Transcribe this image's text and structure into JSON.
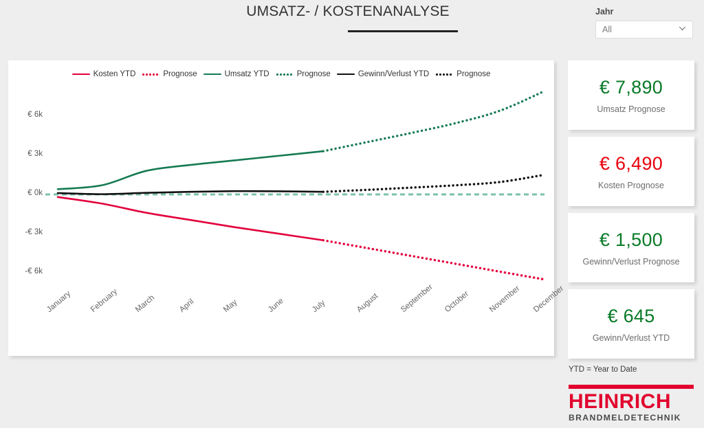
{
  "header": {
    "title": "UMSATZ- / KOSTENANALYSE"
  },
  "slicer": {
    "label": "Jahr",
    "value": "All",
    "icon": "chevron-down-icon"
  },
  "kpis": [
    {
      "value": "€ 7,890",
      "label": "Umsatz Prognose",
      "color": "#0a7a28"
    },
    {
      "value": "€ 6,490",
      "label": "Kosten Prognose",
      "color": "#e8000d"
    },
    {
      "value": "€ 1,500",
      "label": "Gewinn/Verlust Prognose",
      "color": "#0a7a28"
    },
    {
      "value": "€ 645",
      "label": "Gewinn/Verlust YTD",
      "color": "#0a7a28"
    }
  ],
  "footer": {
    "note": "YTD = Year to Date",
    "logo_name": "HEINRICH",
    "logo_sub": "BRANDMELDETECHNIK"
  },
  "chart_data": {
    "type": "line",
    "title": "UMSATZ- / KOSTENANALYSE",
    "xlabel": "",
    "ylabel": "",
    "grid": false,
    "legend_position": "top",
    "categories": [
      "January",
      "February",
      "March",
      "April",
      "May",
      "June",
      "July",
      "August",
      "September",
      "October",
      "November",
      "December"
    ],
    "ytick_labels": [
      "€ 6k",
      "€ 3k",
      "€ 0k",
      "-€ 3k",
      "-€ 6k"
    ],
    "ytick_values": [
      6000,
      3000,
      0,
      -3000,
      -6000
    ],
    "ylim": [
      -7500,
      7500
    ],
    "actual_through": "July",
    "zero_line": {
      "value": 0,
      "style": "dashed",
      "color": "#7dbfad"
    },
    "series": [
      {
        "name": "Kosten YTD",
        "legend_label": "Kosten YTD",
        "color": "#e3003c",
        "style": "solid",
        "values": [
          -200,
          -700,
          -1400,
          -1950,
          -2500,
          -3000,
          -3500,
          null,
          null,
          null,
          null,
          null
        ]
      },
      {
        "name": "Kosten Prognose",
        "legend_label": "Prognose",
        "color": "#e3003c",
        "style": "dotted",
        "values": [
          null,
          null,
          null,
          null,
          null,
          null,
          -3500,
          -4100,
          -4700,
          -5300,
          -5900,
          -6490
        ]
      },
      {
        "name": "Umsatz YTD",
        "legend_label": "Umsatz YTD",
        "color": "#157a52",
        "style": "solid",
        "values": [
          400,
          700,
          1800,
          2250,
          2600,
          2950,
          3300,
          null,
          null,
          null,
          null,
          null
        ]
      },
      {
        "name": "Umsatz Prognose",
        "legend_label": "Prognose",
        "color": "#157a52",
        "style": "dotted",
        "values": [
          null,
          null,
          null,
          null,
          null,
          null,
          3300,
          4000,
          4700,
          5450,
          6400,
          7890
        ]
      },
      {
        "name": "Gewinn/Verlust YTD",
        "legend_label": "Gewinn/Verlust YTD",
        "color": "#111111",
        "style": "solid",
        "values": [
          100,
          20,
          120,
          200,
          250,
          240,
          200,
          null,
          null,
          null,
          null,
          null
        ]
      },
      {
        "name": "Gewinn/Verlust Prognose",
        "legend_label": "Prognose",
        "color": "#111111",
        "style": "dotted",
        "values": [
          null,
          null,
          null,
          null,
          null,
          null,
          200,
          350,
          520,
          700,
          950,
          1500
        ]
      }
    ]
  }
}
